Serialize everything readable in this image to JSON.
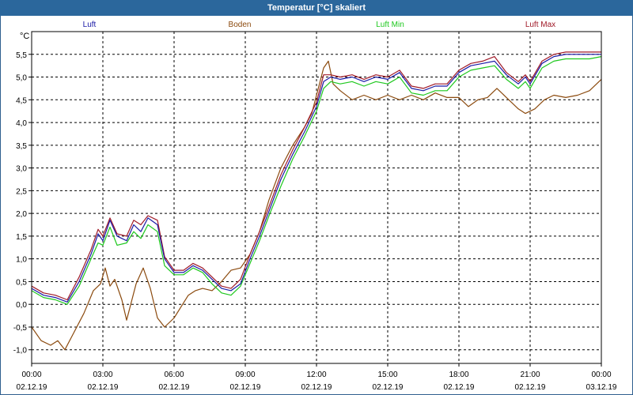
{
  "window": {
    "title": "Temperatur [°C] skaliert"
  },
  "chart_data": {
    "type": "line",
    "title": "Temperatur [°C] skaliert",
    "ylabel": "°C",
    "xlabel": "",
    "ylim": [
      -1.3,
      6.0
    ],
    "xlim": [
      0,
      24
    ],
    "grid": true,
    "legend_position": "top",
    "y_ticks": [
      "-1,0",
      "-0,5",
      "0,0",
      "0,5",
      "1,0",
      "1,5",
      "2,0",
      "2,5",
      "3,0",
      "3,5",
      "4,0",
      "4,5",
      "5,0",
      "5,5"
    ],
    "y_tick_values": [
      -1.0,
      -0.5,
      0.0,
      0.5,
      1.0,
      1.5,
      2.0,
      2.5,
      3.0,
      3.5,
      4.0,
      4.5,
      5.0,
      5.5
    ],
    "x_ticks": [
      {
        "time": "00:00",
        "date": "02.12.19",
        "hour": 0
      },
      {
        "time": "03:00",
        "date": "02.12.19",
        "hour": 3
      },
      {
        "time": "06:00",
        "date": "02.12.19",
        "hour": 6
      },
      {
        "time": "09:00",
        "date": "02.12.19",
        "hour": 9
      },
      {
        "time": "12:00",
        "date": "02.12.19",
        "hour": 12
      },
      {
        "time": "15:00",
        "date": "02.12.19",
        "hour": 15
      },
      {
        "time": "18:00",
        "date": "02.12.19",
        "hour": 18
      },
      {
        "time": "21:00",
        "date": "02.12.19",
        "hour": 21
      },
      {
        "time": "00:00",
        "date": "03.12.19",
        "hour": 24
      }
    ],
    "series": [
      {
        "name": "Luft",
        "color": "#1a1aa6",
        "points": [
          [
            0,
            0.35
          ],
          [
            0.5,
            0.2
          ],
          [
            1,
            0.15
          ],
          [
            1.5,
            0.05
          ],
          [
            2,
            0.5
          ],
          [
            2.5,
            1.1
          ],
          [
            2.8,
            1.55
          ],
          [
            3,
            1.4
          ],
          [
            3.3,
            1.85
          ],
          [
            3.6,
            1.5
          ],
          [
            4,
            1.4
          ],
          [
            4.3,
            1.75
          ],
          [
            4.6,
            1.6
          ],
          [
            4.9,
            1.9
          ],
          [
            5.3,
            1.75
          ],
          [
            5.6,
            1.0
          ],
          [
            6,
            0.7
          ],
          [
            6.4,
            0.7
          ],
          [
            6.8,
            0.85
          ],
          [
            7.2,
            0.75
          ],
          [
            7.6,
            0.55
          ],
          [
            8,
            0.35
          ],
          [
            8.4,
            0.3
          ],
          [
            8.8,
            0.45
          ],
          [
            9.2,
            1.0
          ],
          [
            9.6,
            1.5
          ],
          [
            10,
            2.05
          ],
          [
            10.5,
            2.75
          ],
          [
            11,
            3.3
          ],
          [
            11.5,
            3.8
          ],
          [
            12,
            4.35
          ],
          [
            12.3,
            4.9
          ],
          [
            12.6,
            5.0
          ],
          [
            13,
            4.95
          ],
          [
            13.5,
            5.0
          ],
          [
            14,
            4.9
          ],
          [
            14.5,
            5.0
          ],
          [
            15,
            4.95
          ],
          [
            15.5,
            5.1
          ],
          [
            16,
            4.75
          ],
          [
            16.5,
            4.7
          ],
          [
            17,
            4.8
          ],
          [
            17.5,
            4.8
          ],
          [
            18,
            5.1
          ],
          [
            18.5,
            5.25
          ],
          [
            19,
            5.3
          ],
          [
            19.5,
            5.35
          ],
          [
            20,
            5.05
          ],
          [
            20.5,
            4.85
          ],
          [
            20.8,
            5.0
          ],
          [
            21,
            4.85
          ],
          [
            21.5,
            5.3
          ],
          [
            22,
            5.45
          ],
          [
            22.5,
            5.5
          ],
          [
            23,
            5.5
          ],
          [
            23.5,
            5.5
          ],
          [
            24,
            5.5
          ]
        ]
      },
      {
        "name": "Boden",
        "color": "#8b4a0e",
        "points": [
          [
            0,
            -0.5
          ],
          [
            0.4,
            -0.8
          ],
          [
            0.8,
            -0.9
          ],
          [
            1.1,
            -0.8
          ],
          [
            1.4,
            -1.0
          ],
          [
            1.7,
            -0.7
          ],
          [
            2.2,
            -0.2
          ],
          [
            2.6,
            0.3
          ],
          [
            2.9,
            0.45
          ],
          [
            3.1,
            0.8
          ],
          [
            3.3,
            0.4
          ],
          [
            3.5,
            0.55
          ],
          [
            3.8,
            0.1
          ],
          [
            4,
            -0.35
          ],
          [
            4.4,
            0.45
          ],
          [
            4.7,
            0.8
          ],
          [
            5,
            0.35
          ],
          [
            5.3,
            -0.3
          ],
          [
            5.6,
            -0.5
          ],
          [
            6,
            -0.3
          ],
          [
            6.3,
            -0.05
          ],
          [
            6.6,
            0.2
          ],
          [
            6.9,
            0.3
          ],
          [
            7.2,
            0.35
          ],
          [
            7.6,
            0.3
          ],
          [
            8,
            0.5
          ],
          [
            8.4,
            0.75
          ],
          [
            8.8,
            0.8
          ],
          [
            9.2,
            1.1
          ],
          [
            9.6,
            1.6
          ],
          [
            10,
            2.3
          ],
          [
            10.5,
            3.0
          ],
          [
            11,
            3.5
          ],
          [
            11.5,
            3.9
          ],
          [
            11.8,
            4.2
          ],
          [
            12,
            4.6
          ],
          [
            12.3,
            5.2
          ],
          [
            12.5,
            5.35
          ],
          [
            12.7,
            4.85
          ],
          [
            13,
            4.7
          ],
          [
            13.5,
            4.5
          ],
          [
            14,
            4.6
          ],
          [
            14.5,
            4.5
          ],
          [
            15,
            4.6
          ],
          [
            15.5,
            4.5
          ],
          [
            16,
            4.6
          ],
          [
            16.5,
            4.5
          ],
          [
            17,
            4.65
          ],
          [
            17.5,
            4.55
          ],
          [
            18,
            4.55
          ],
          [
            18.4,
            4.35
          ],
          [
            18.8,
            4.5
          ],
          [
            19.2,
            4.55
          ],
          [
            19.6,
            4.75
          ],
          [
            20,
            4.55
          ],
          [
            20.5,
            4.3
          ],
          [
            20.8,
            4.2
          ],
          [
            21.2,
            4.3
          ],
          [
            21.6,
            4.5
          ],
          [
            22,
            4.6
          ],
          [
            22.5,
            4.55
          ],
          [
            23,
            4.6
          ],
          [
            23.5,
            4.7
          ],
          [
            24,
            4.95
          ]
        ]
      },
      {
        "name": "Luft Min",
        "color": "#1ec81e",
        "points": [
          [
            0,
            0.3
          ],
          [
            0.5,
            0.15
          ],
          [
            1,
            0.1
          ],
          [
            1.5,
            0.0
          ],
          [
            2,
            0.4
          ],
          [
            2.5,
            1.0
          ],
          [
            2.8,
            1.35
          ],
          [
            3,
            1.3
          ],
          [
            3.3,
            1.7
          ],
          [
            3.6,
            1.3
          ],
          [
            4,
            1.35
          ],
          [
            4.3,
            1.6
          ],
          [
            4.6,
            1.45
          ],
          [
            4.9,
            1.75
          ],
          [
            5.3,
            1.6
          ],
          [
            5.6,
            0.85
          ],
          [
            6,
            0.65
          ],
          [
            6.4,
            0.65
          ],
          [
            6.8,
            0.8
          ],
          [
            7.2,
            0.7
          ],
          [
            7.6,
            0.45
          ],
          [
            8,
            0.25
          ],
          [
            8.4,
            0.2
          ],
          [
            8.8,
            0.4
          ],
          [
            9.2,
            0.9
          ],
          [
            9.6,
            1.4
          ],
          [
            10,
            1.95
          ],
          [
            10.5,
            2.6
          ],
          [
            11,
            3.2
          ],
          [
            11.5,
            3.7
          ],
          [
            12,
            4.25
          ],
          [
            12.3,
            4.75
          ],
          [
            12.6,
            4.9
          ],
          [
            13,
            4.85
          ],
          [
            13.5,
            4.9
          ],
          [
            14,
            4.8
          ],
          [
            14.5,
            4.9
          ],
          [
            15,
            4.85
          ],
          [
            15.5,
            5.0
          ],
          [
            16,
            4.65
          ],
          [
            16.5,
            4.6
          ],
          [
            17,
            4.7
          ],
          [
            17.5,
            4.7
          ],
          [
            18,
            5.0
          ],
          [
            18.5,
            5.15
          ],
          [
            19,
            5.2
          ],
          [
            19.5,
            5.25
          ],
          [
            20,
            4.95
          ],
          [
            20.5,
            4.75
          ],
          [
            20.8,
            4.9
          ],
          [
            21,
            4.75
          ],
          [
            21.5,
            5.2
          ],
          [
            22,
            5.35
          ],
          [
            22.5,
            5.4
          ],
          [
            23,
            5.4
          ],
          [
            23.5,
            5.4
          ],
          [
            24,
            5.45
          ]
        ]
      },
      {
        "name": "Luft Max",
        "color": "#a01a28",
        "points": [
          [
            0,
            0.4
          ],
          [
            0.5,
            0.25
          ],
          [
            1,
            0.2
          ],
          [
            1.5,
            0.1
          ],
          [
            2,
            0.6
          ],
          [
            2.5,
            1.2
          ],
          [
            2.8,
            1.65
          ],
          [
            3,
            1.5
          ],
          [
            3.3,
            1.9
          ],
          [
            3.6,
            1.55
          ],
          [
            4,
            1.5
          ],
          [
            4.3,
            1.85
          ],
          [
            4.6,
            1.75
          ],
          [
            4.9,
            1.95
          ],
          [
            5.3,
            1.85
          ],
          [
            5.6,
            1.05
          ],
          [
            6,
            0.75
          ],
          [
            6.4,
            0.75
          ],
          [
            6.8,
            0.9
          ],
          [
            7.2,
            0.8
          ],
          [
            7.6,
            0.6
          ],
          [
            8,
            0.4
          ],
          [
            8.4,
            0.35
          ],
          [
            8.8,
            0.55
          ],
          [
            9.2,
            1.1
          ],
          [
            9.6,
            1.6
          ],
          [
            10,
            2.15
          ],
          [
            10.5,
            2.85
          ],
          [
            11,
            3.4
          ],
          [
            11.5,
            3.9
          ],
          [
            12,
            4.45
          ],
          [
            12.3,
            5.05
          ],
          [
            12.6,
            5.05
          ],
          [
            13,
            5.0
          ],
          [
            13.5,
            5.05
          ],
          [
            14,
            4.95
          ],
          [
            14.5,
            5.05
          ],
          [
            15,
            5.0
          ],
          [
            15.5,
            5.15
          ],
          [
            16,
            4.8
          ],
          [
            16.5,
            4.75
          ],
          [
            17,
            4.85
          ],
          [
            17.5,
            4.85
          ],
          [
            18,
            5.15
          ],
          [
            18.5,
            5.3
          ],
          [
            19,
            5.35
          ],
          [
            19.5,
            5.45
          ],
          [
            20,
            5.1
          ],
          [
            20.5,
            4.9
          ],
          [
            20.8,
            5.05
          ],
          [
            21,
            4.9
          ],
          [
            21.5,
            5.35
          ],
          [
            22,
            5.5
          ],
          [
            22.5,
            5.55
          ],
          [
            23,
            5.55
          ],
          [
            23.5,
            5.55
          ],
          [
            24,
            5.55
          ]
        ]
      }
    ]
  }
}
